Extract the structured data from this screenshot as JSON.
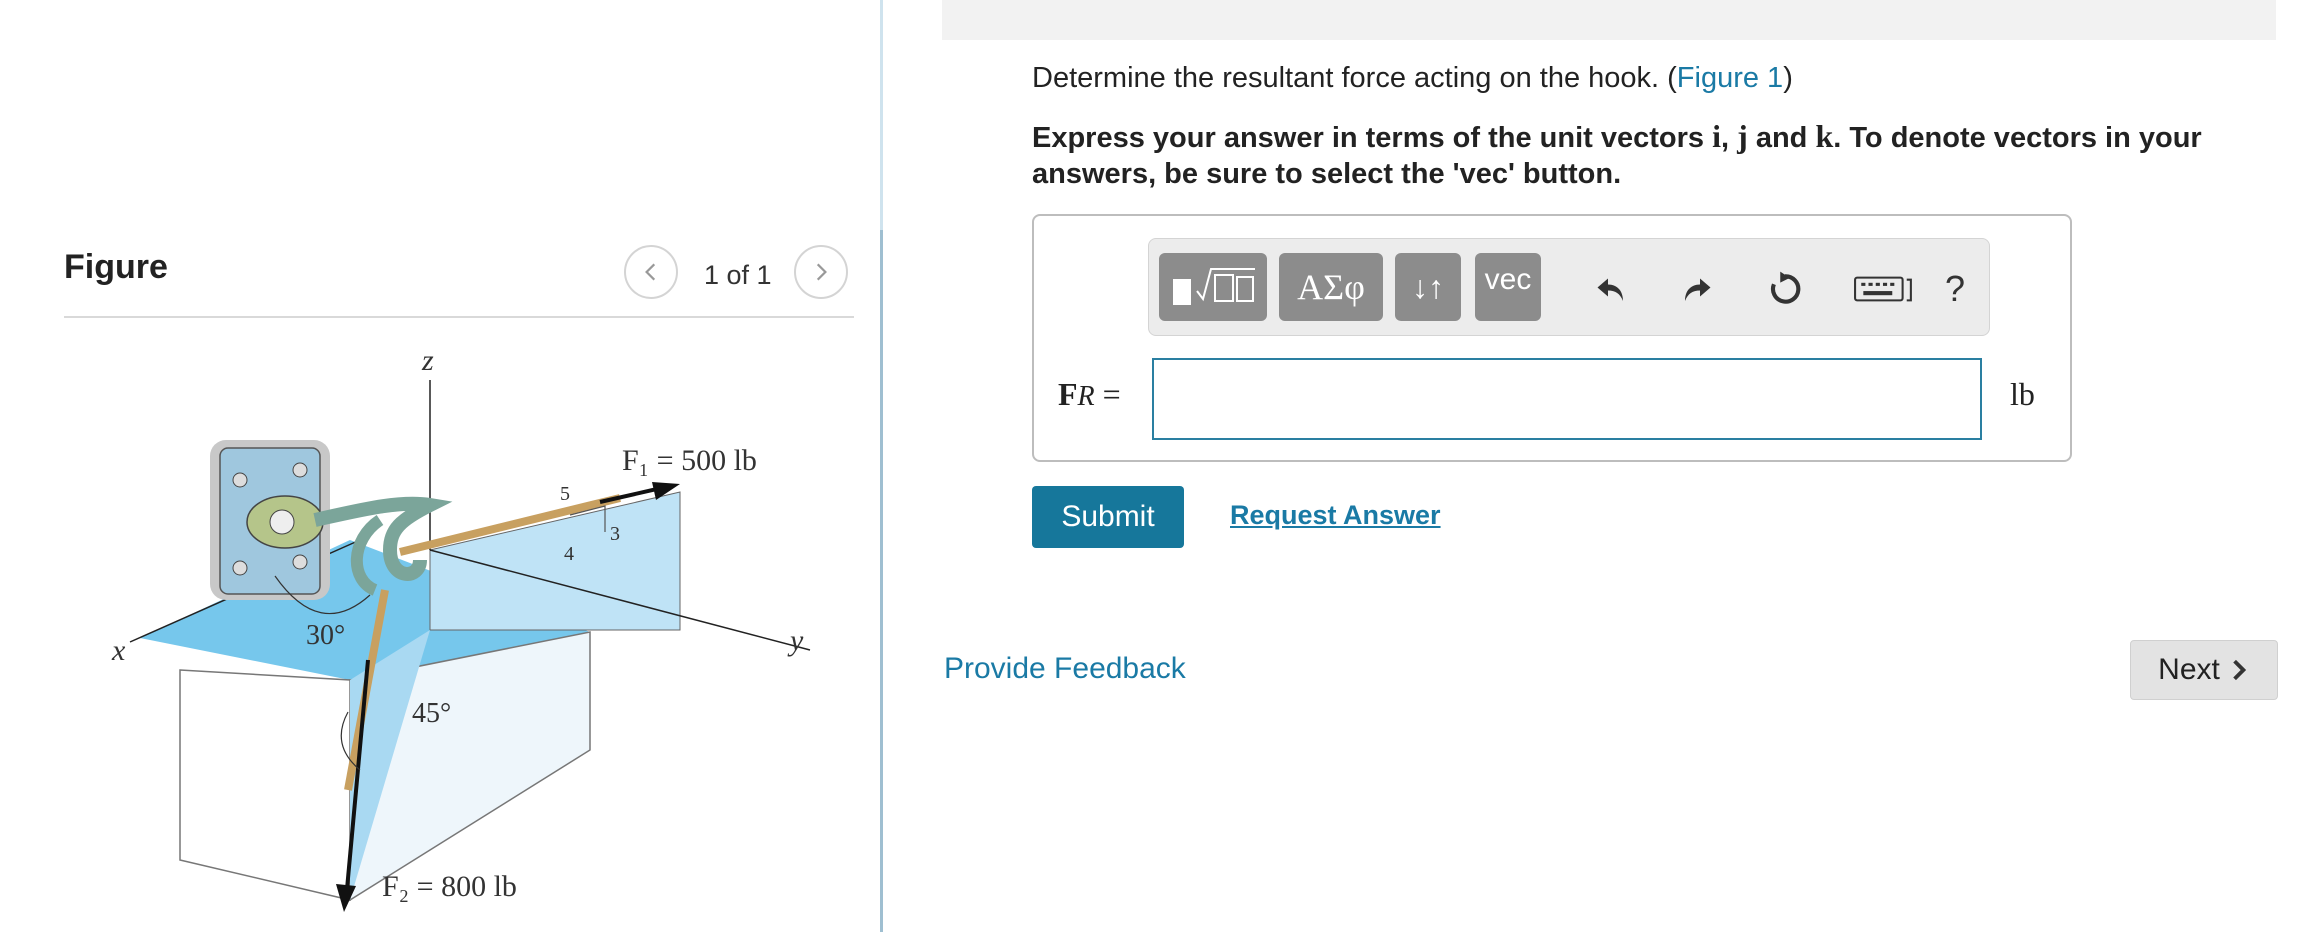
{
  "figure_panel": {
    "title": "Figure",
    "pager_text": "1 of 1",
    "labels": {
      "z_axis": "z",
      "x_axis": "x",
      "y_axis": "y",
      "f1_label": "F₁ = 500 lb",
      "f2_label": "F₂ = 800 lb",
      "angle_30": "30°",
      "angle_45": "45°",
      "tri_5": "5",
      "tri_4": "4",
      "tri_3": "3"
    }
  },
  "question": {
    "text_prefix": "Determine the resultant force acting on the hook. (",
    "figure_link": "Figure 1",
    "text_suffix": ")",
    "instruction_1": "Express your answer in terms of the unit vectors ",
    "unit_i": "i",
    "comma": ", ",
    "unit_j": "j",
    "and": " and ",
    "unit_k": "k",
    "instruction_2": ". To denote vectors in your answers, be sure to select the 'vec' button."
  },
  "toolbar": {
    "greek_label": "ΑΣφ",
    "arrows_label": "↓↑",
    "vec_label": "vec",
    "help_label": "?"
  },
  "answer": {
    "label_main": "F",
    "label_sub": "R",
    "label_eq": " =",
    "input_value": "",
    "unit": "lb"
  },
  "actions": {
    "submit_label": "Submit",
    "request_answer_label": "Request Answer",
    "feedback_label": "Provide Feedback",
    "next_label": "Next"
  }
}
